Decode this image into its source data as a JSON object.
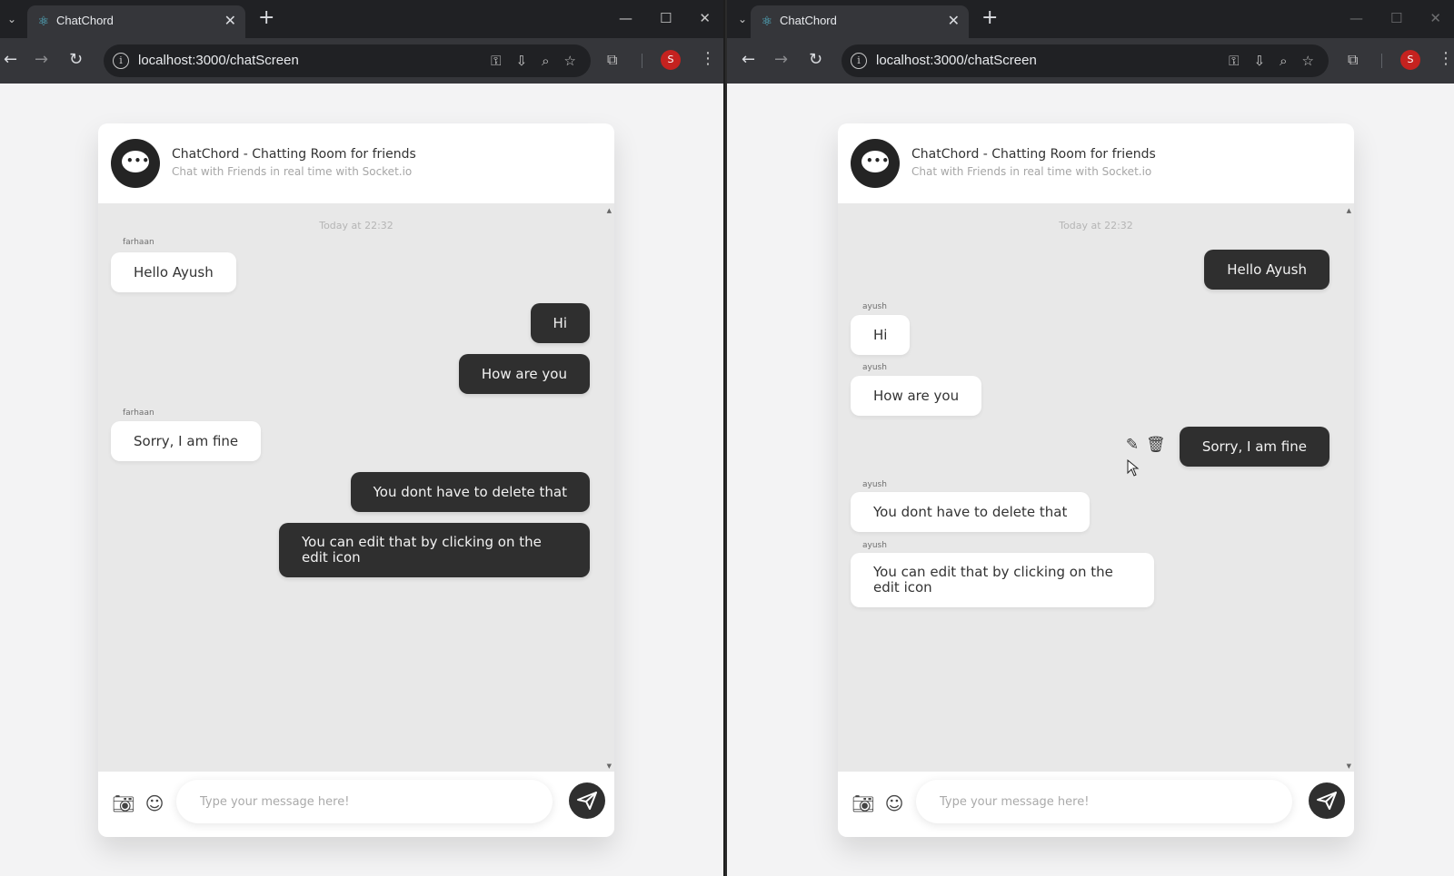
{
  "left_window": {
    "tab_title": "ChatChord",
    "url": "localhost:3000/chatScreen",
    "profile_initial": "S",
    "chat": {
      "title": "ChatChord - Chatting Room for friends",
      "subtitle": "Chat with Friends in real time with Socket.io",
      "timestamp": "Today at 22:32",
      "messages": [
        {
          "sender": "farhaan",
          "text": "Hello Ayush",
          "direction": "incoming"
        },
        {
          "sender": "",
          "text": "Hi",
          "direction": "outgoing"
        },
        {
          "sender": "",
          "text": "How are you",
          "direction": "outgoing"
        },
        {
          "sender": "farhaan",
          "text": "Sorry, I am fine",
          "direction": "incoming"
        },
        {
          "sender": "",
          "text": "You dont have to delete that",
          "direction": "outgoing"
        },
        {
          "sender": "",
          "text": "You can edit that by clicking on the edit icon",
          "direction": "outgoing"
        }
      ],
      "input_placeholder": "Type your message here!"
    }
  },
  "right_window": {
    "tab_title": "ChatChord",
    "url": "localhost:3000/chatScreen",
    "profile_initial": "S",
    "chat": {
      "title": "ChatChord - Chatting Room for friends",
      "subtitle": "Chat with Friends in real time with Socket.io",
      "timestamp": "Today at 22:32",
      "messages": [
        {
          "sender": "",
          "text": "Hello Ayush",
          "direction": "outgoing"
        },
        {
          "sender": "ayush",
          "text": "Hi",
          "direction": "incoming"
        },
        {
          "sender": "ayush",
          "text": "How are you",
          "direction": "incoming"
        },
        {
          "sender": "",
          "text": "Sorry, I am fine",
          "direction": "outgoing",
          "hover_actions": [
            "edit-icon",
            "delete-icon"
          ]
        },
        {
          "sender": "ayush",
          "text": "You dont have to delete that",
          "direction": "incoming"
        },
        {
          "sender": "ayush",
          "text": "You can edit that by clicking on the edit icon",
          "direction": "incoming"
        }
      ],
      "input_placeholder": "Type your message here!"
    }
  },
  "icons": {
    "tab_favicon": "react-icon",
    "browser_toolbar": [
      "back-icon",
      "forward-icon",
      "reload-icon",
      "info-icon",
      "key-icon",
      "install-icon",
      "zoom-icon",
      "star-icon",
      "extensions-icon",
      "menu-icon"
    ],
    "chat_footer": [
      "camera-icon",
      "emoji-icon",
      "send-icon"
    ]
  },
  "colors": {
    "bubble_outgoing": "#2f2f2f",
    "bubble_incoming": "#ffffff",
    "chat_background": "#e8e8e8",
    "profile_badge": "#c5221f"
  }
}
